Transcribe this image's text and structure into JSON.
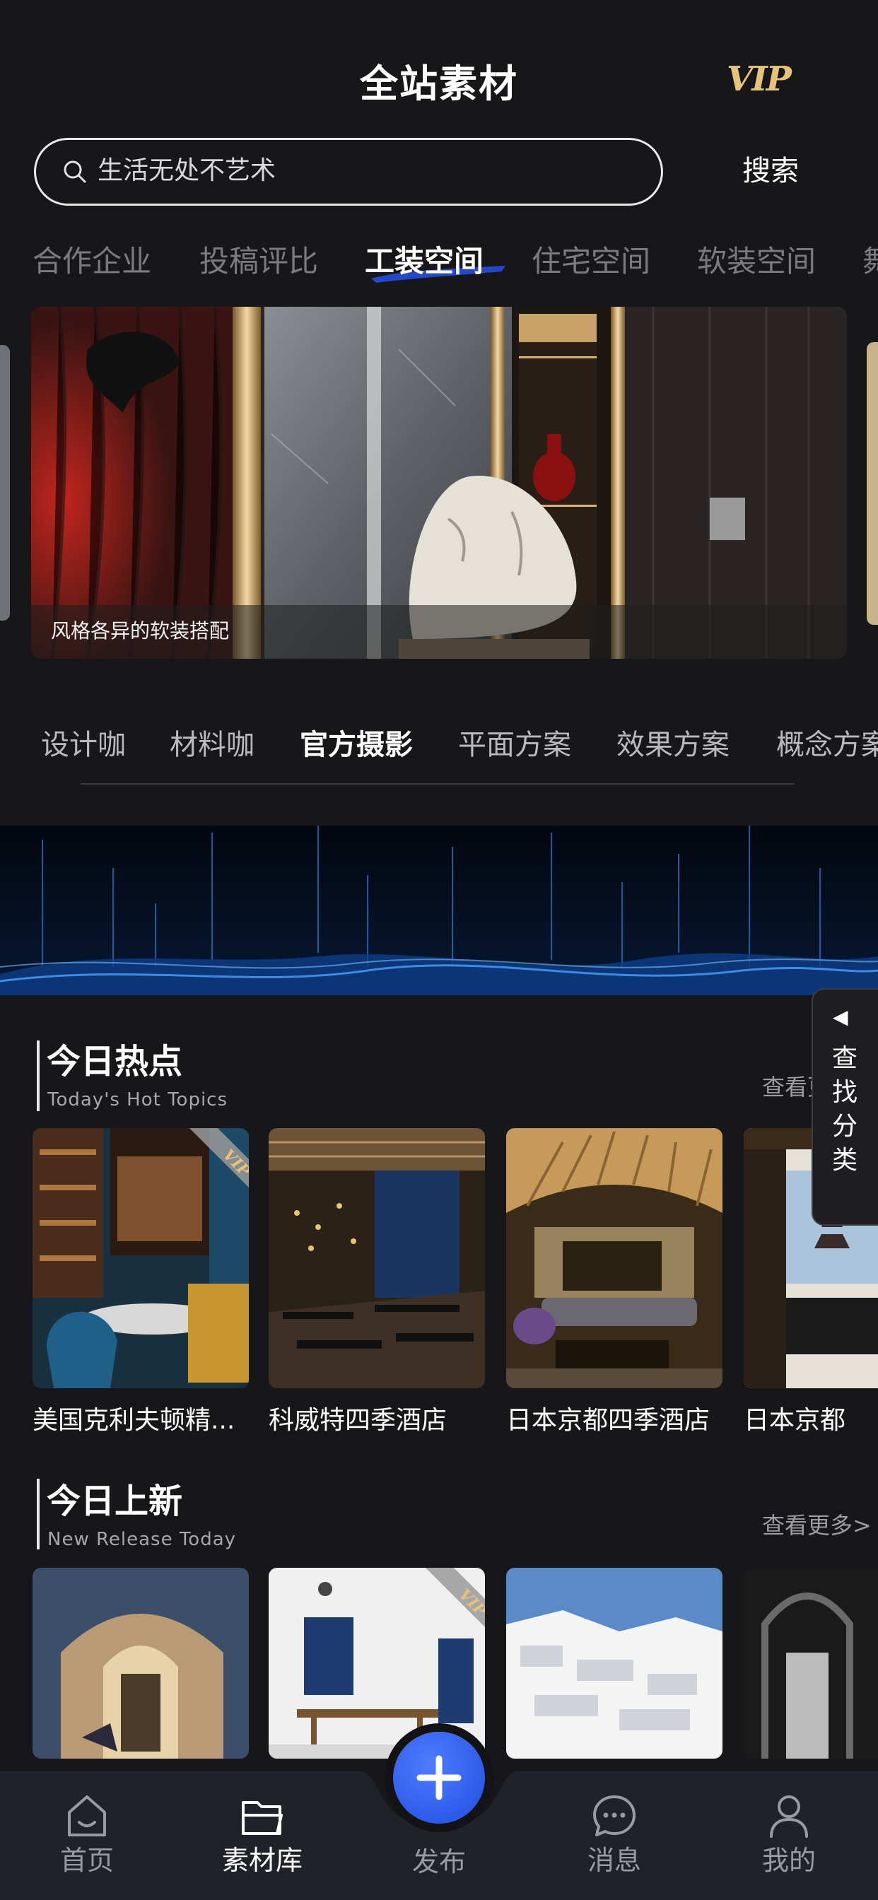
{
  "header": {
    "title": "全站素材",
    "vip_label": "VIP"
  },
  "search": {
    "placeholder": "生活无处不艺术",
    "button_label": "搜索"
  },
  "category_tabs": [
    {
      "label": "合作企业"
    },
    {
      "label": "投稿评比"
    },
    {
      "label": "工装空间",
      "active": true
    },
    {
      "label": "住宅空间"
    },
    {
      "label": "软装空间"
    },
    {
      "label": "舞"
    }
  ],
  "banner": {
    "caption": "风格各异的软装搭配"
  },
  "sub_tabs": [
    {
      "label": "设计咖"
    },
    {
      "label": "材料咖"
    },
    {
      "label": "官方摄影",
      "active": true
    },
    {
      "label": "平面方案"
    },
    {
      "label": "效果方案"
    },
    {
      "label": "概念方案"
    }
  ],
  "side_tab": {
    "label": "查找分类"
  },
  "hot_section": {
    "title": "今日热点",
    "subtitle": "Today's Hot Topics",
    "more_label": "查看更多>",
    "cards": [
      {
        "title": "美国克利夫顿精...",
        "vip": true
      },
      {
        "title": "科威特四季酒店",
        "vip": false
      },
      {
        "title": "日本京都四季酒店",
        "vip": false
      },
      {
        "title": "日本京都",
        "vip": false
      }
    ]
  },
  "new_section": {
    "title": "今日上新",
    "subtitle": "New Release Today",
    "more_label": "查看更多>",
    "cards": [
      {
        "vip": false
      },
      {
        "vip": true
      },
      {
        "vip": false
      },
      {
        "vip": false
      }
    ]
  },
  "bottom_nav": {
    "items": [
      {
        "label": "首页",
        "icon": "home-icon"
      },
      {
        "label": "素材库",
        "icon": "folder-icon",
        "active": true
      },
      {
        "label": "发布",
        "icon": "plus-icon"
      },
      {
        "label": "消息",
        "icon": "message-icon"
      },
      {
        "label": "我的",
        "icon": "user-icon"
      }
    ]
  },
  "colors": {
    "background": "#17171a",
    "accent_blue": "#2e5ef5",
    "vip_gold": "#e6c27a"
  }
}
